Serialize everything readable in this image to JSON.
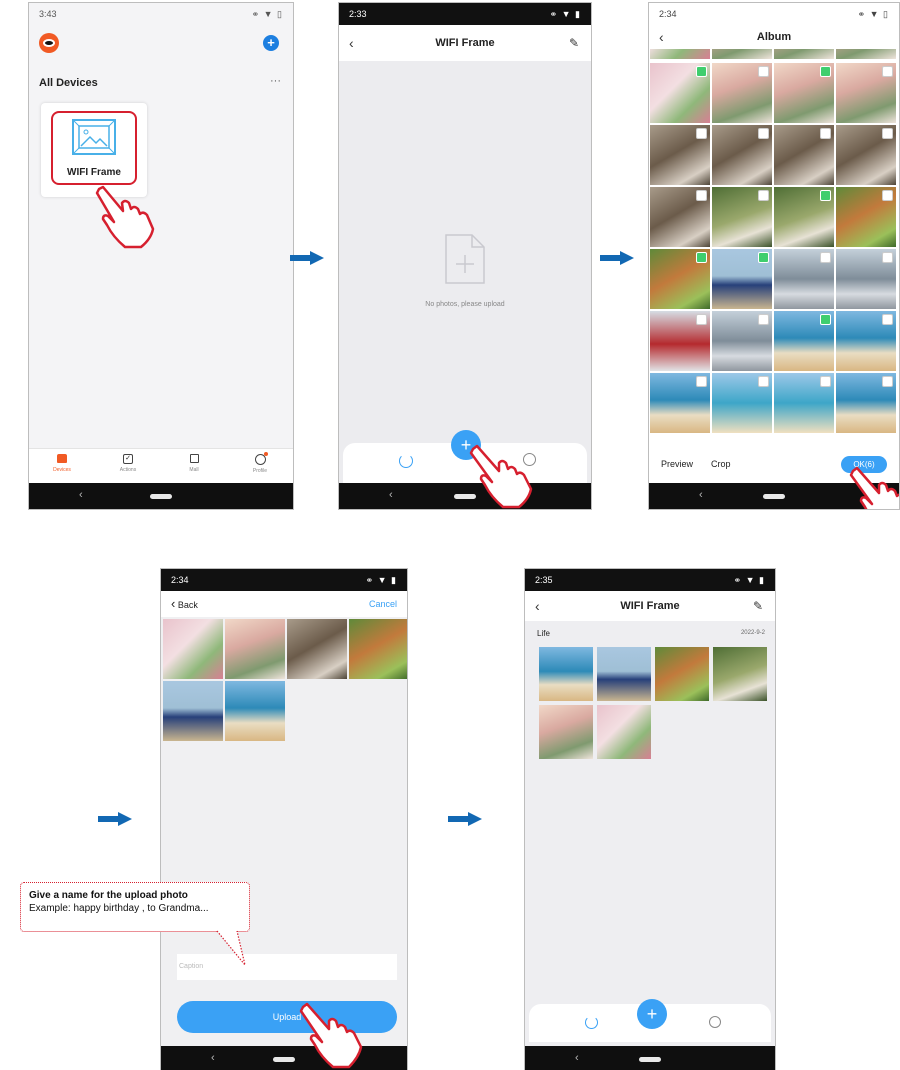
{
  "colors": {
    "accent": "#3aa1f5",
    "arrow": "#1268b3",
    "highlight": "#d6202f",
    "check": "#3fce6e"
  },
  "screen1": {
    "time": "3:43",
    "section_title": "All Devices",
    "more_label": "···",
    "device_name": "WIFI Frame",
    "tabs": [
      {
        "label": "Devices",
        "icon": "home-icon"
      },
      {
        "label": "Actions",
        "icon": "checkbox-icon"
      },
      {
        "label": "Mall",
        "icon": "bag-icon"
      },
      {
        "label": "Profile",
        "icon": "profile-icon"
      }
    ]
  },
  "screen2": {
    "time": "2:33",
    "title": "WIFI Frame",
    "empty_text": "No photos, please upload",
    "fab_label": "+"
  },
  "screen3": {
    "time": "2:34",
    "title": "Album",
    "preview_label": "Preview",
    "crop_label": "Crop",
    "ok_label": "OK(6)"
  },
  "screen4": {
    "time": "2:34",
    "back_label": "Back",
    "cancel_label": "Cancel",
    "caption_placeholder": "Caption",
    "upload_label": "Upload",
    "callout_title": "Give a name for the upload photo",
    "callout_text": "Example: happy birthday , to Grandma..."
  },
  "screen5": {
    "time": "2:35",
    "title": "WIFI Frame",
    "album_name": "Life",
    "album_date": "2022-9-2",
    "fab_label": "+"
  }
}
